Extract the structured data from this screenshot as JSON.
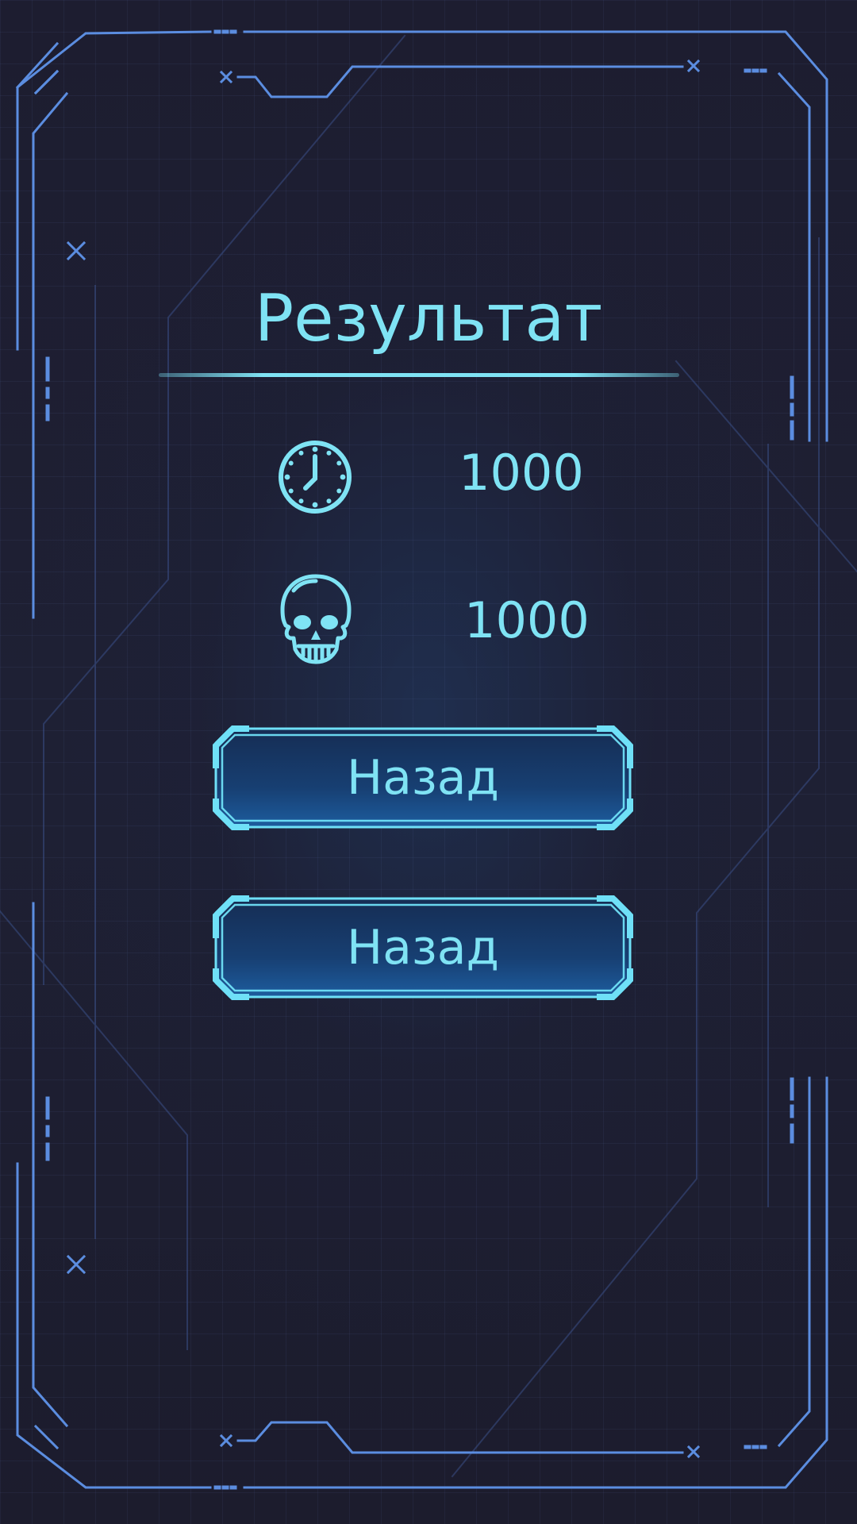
{
  "result_panel": {
    "title": "Результат",
    "stats": [
      {
        "icon": "clock-icon",
        "value": "1000"
      },
      {
        "icon": "skull-icon",
        "value": "1000"
      }
    ],
    "buttons": [
      {
        "label": "Назад"
      },
      {
        "label": "Назад"
      }
    ]
  },
  "colors": {
    "background": "#1e2034",
    "frame_lines": "#5b8de0",
    "accent_text": "#7fe3f4",
    "button_fill_top": "#16345e",
    "button_fill_bottom": "#1d5a9a",
    "button_border": "#6fe0f7"
  }
}
